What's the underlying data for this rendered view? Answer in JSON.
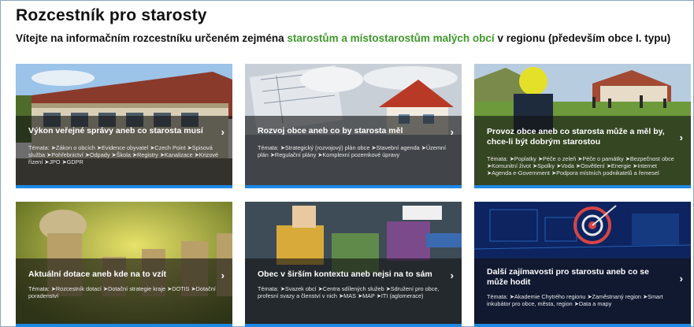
{
  "header": {
    "title": "Rozcestník pro starosty",
    "intro_before": "Vítejte na informačním rozcestníku určeném zejména ",
    "intro_highlight": "starostům a místostarostům malých obcí",
    "intro_after": " v regionu (především obce I. typu)"
  },
  "cards": [
    {
      "title": "Výkon veřejné správy aneb co starosta musí",
      "topics": "Témata: ➤Zákon o obcích ➤Evidence obyvatel ➤Czech Point ➤Spisová služba ➤Pohřebnictví ➤Odpady ➤Škola ➤Registry ➤Kanalizace ➤Krizové řízení ➤JPO ➤GDPR"
    },
    {
      "title": "Rozvoj obce aneb co by starosta měl",
      "topics": "Témata: ➤Strategický (rozvojový) plán obce ➤Stavební agenda ➤Územní plán ➤Regulační plány ➤Komplexní pozemkové úpravy"
    },
    {
      "title": "Provoz obce aneb co starosta může a měl by, chce-li být dobrým starostou",
      "topics": "Témata: ➤Poplatky ➤Péče o zeleň ➤Péče o památky ➤Bezpečnost obce ➤Komunitní život ➤Spolky ➤Voda ➤Osvětlení ➤Energie ➤Internet ➤Agenda e-Government ➤Podpora místních podnikatelů a řemesel"
    },
    {
      "title": "Aktuální dotace aneb kde na to vzít",
      "topics": "Témata: ➤Rozcestník dotací ➤Dotační strategie kraje ➤DOTIS ➤Dotační poradenství"
    },
    {
      "title": "Obec v širším kontextu aneb nejsi na to sám",
      "topics": "Témata: ➤Svazek obcí ➤Centra sdílených služeb ➤Sdružení pro obce, profesní svazy a členství v nich ➤MAS ➤MAP ➤ITI (aglomerace)"
    },
    {
      "title": "Další zajímavosti pro starostu aneb co se může hodit",
      "topics": "Témata: ➤Akademie Chytrého regionu ➤Zaměstnaný region ➤Smart inkubátor pro obce, města, region ➤Data a mapy"
    }
  ],
  "chevron": "›",
  "colors": {
    "accent_green": "#3f9a2a",
    "card_bar_blue": "#1e88e5"
  }
}
